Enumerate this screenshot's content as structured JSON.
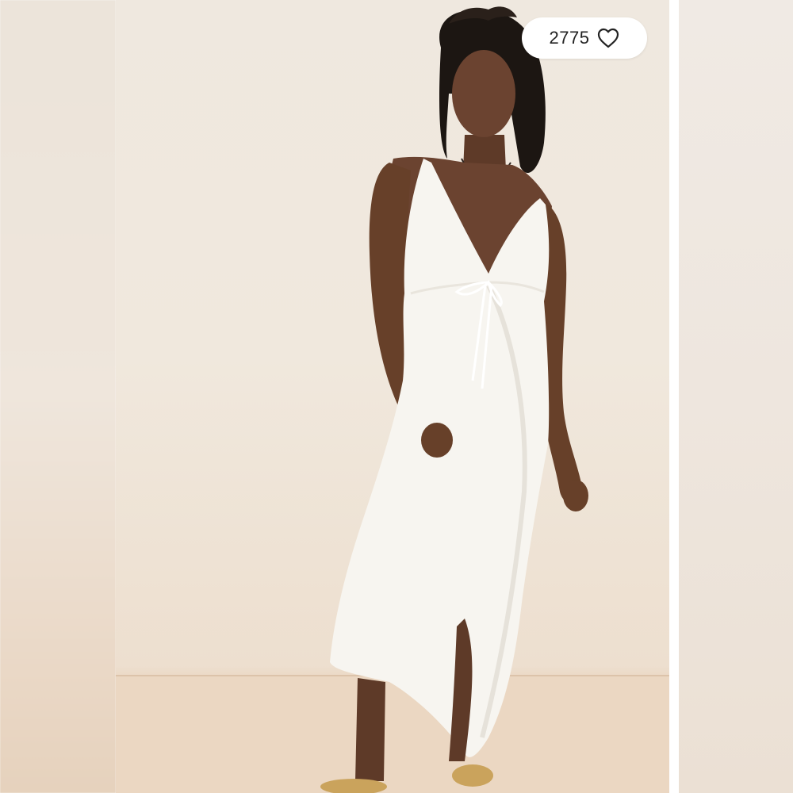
{
  "listing": {
    "like_count": "2775",
    "like_icon": "heart-outline-icon"
  },
  "colors": {
    "background_wall": "#efe8df",
    "floor": "#ebd7c1",
    "dress": "#f7f5f0",
    "skin": "#6b4330",
    "pill": "#ffffff"
  }
}
